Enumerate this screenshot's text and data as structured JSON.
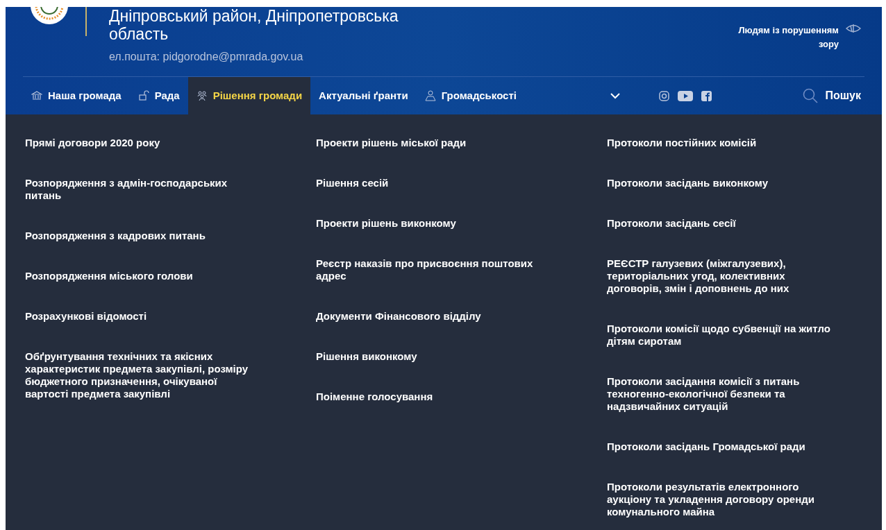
{
  "header": {
    "title": "Дніпровський район, Дніпропетровська область",
    "email": "ел.пошта: pidgorodne@pmrada.gov.ua",
    "accessibility_link": "Людям із порушенням зору"
  },
  "nav": {
    "tabs": [
      {
        "label": "Наша громада",
        "selected": false
      },
      {
        "label": "Рада",
        "selected": false
      },
      {
        "label": "Рішення громади",
        "selected": true
      },
      {
        "label": "Актуальні ґранти",
        "selected": false
      },
      {
        "label": "Громадськості",
        "selected": false
      }
    ],
    "search_label": "Пошук"
  },
  "menu": {
    "columns": [
      [
        "Прямі договори 2020 року",
        "Розпорядження з адмін-господарських питань",
        "Розпорядження з кадрових питань",
        "Розпорядження міського голови",
        "Розрахункові відомості",
        "Обґрунтування технічних та якісних характеристик предмета закупівлі, розміру бюджетного призначення, очікуваної вартості предмета закупівлі"
      ],
      [
        "Проекти рішень міської ради",
        "Рішення сесій",
        "Проекти рішень виконкому",
        "Реєстр наказів про присвоєння поштових адрес",
        "Документи Фінансового відділу",
        "Рішення виконкому",
        "Поіменне голосування"
      ],
      [
        "Протоколи постійних комісій",
        "Протоколи засідань виконкому",
        "Протоколи засідань сесії",
        "РЕЄСТР галузевих (міжгалузевих), територіальних угод, колективних договорів, змін і доповнень до них",
        "Протоколи комісії щодо субвенції на житло дітям сиротам",
        "Протоколи засідання комісії з питань техногенно-екологічної безпеки та надзвичайних ситуацій",
        "Протоколи засідань Громадської ради",
        "Протоколи результатів електронного аукціону та укладення договору оренди комунального майна"
      ]
    ]
  }
}
